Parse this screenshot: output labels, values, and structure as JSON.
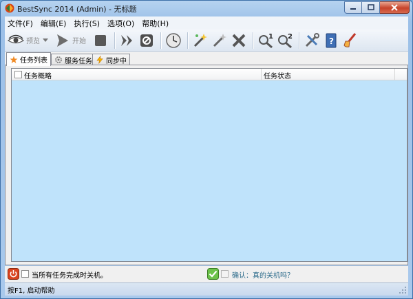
{
  "window": {
    "title": "BestSync 2014 (Admin) - 无标题"
  },
  "menu": [
    {
      "label": "文件(F)"
    },
    {
      "label": "编辑(E)"
    },
    {
      "label": "执行(S)"
    },
    {
      "label": "选项(O)"
    },
    {
      "label": "帮助(H)"
    }
  ],
  "toolbar": {
    "preview_label": "预览",
    "start_label": "开始",
    "icons": [
      "eye-icon",
      "play-icon",
      "stop-icon",
      "fast-forward-icon",
      "cancel-icon",
      "schedule-clock-icon",
      "new-task-wand-icon",
      "edit-task-wand-icon",
      "delete-task-icon",
      "find-1-icon",
      "find-2-icon",
      "tools-icon",
      "help-book-icon",
      "brush-icon"
    ]
  },
  "tabs": [
    {
      "label": "任务列表",
      "icon": "star-icon"
    },
    {
      "label": "服务任务",
      "icon": "service-gear-icon"
    },
    {
      "label": "同步中",
      "icon": "lightning-icon"
    }
  ],
  "task_grid": {
    "columns": [
      "任务概略",
      "任务状态"
    ],
    "rows": []
  },
  "options": {
    "shutdown_label": "当所有任务完成时关机。",
    "confirm_label": "确认：真的关机吗？"
  },
  "status": {
    "text": "按F1, 启动帮助"
  },
  "colors": {
    "grid_bg": "#bfe3fb",
    "title_gradient": "#9cc0e8",
    "close_red": "#c7432a"
  }
}
